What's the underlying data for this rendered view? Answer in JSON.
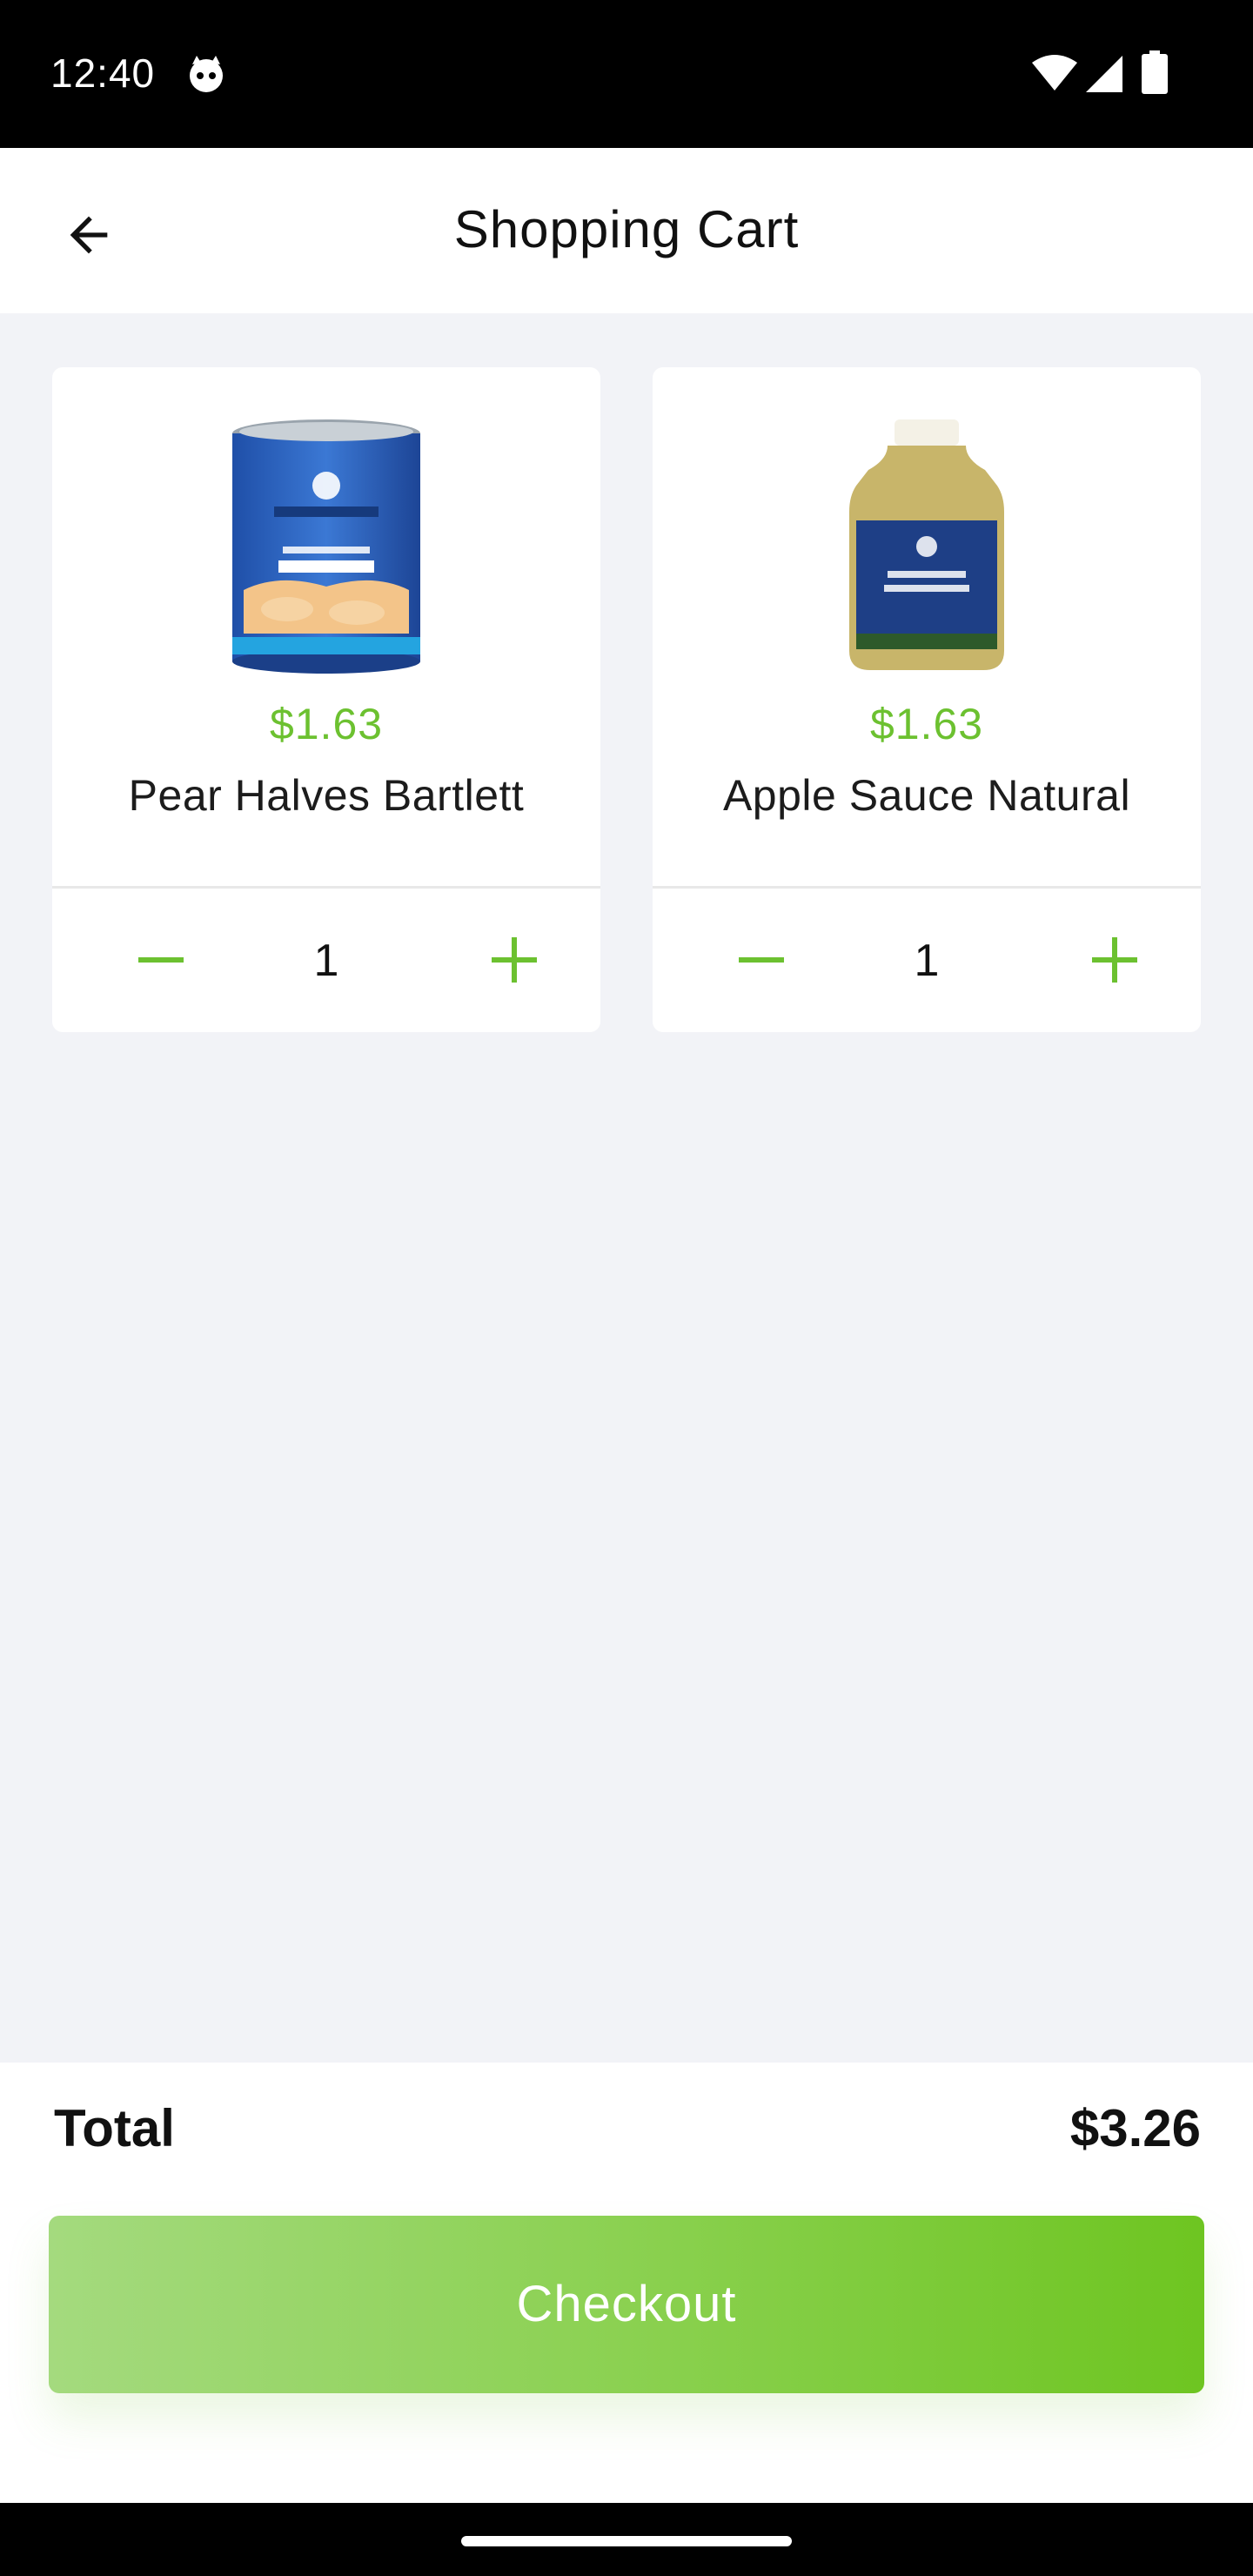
{
  "status_bar": {
    "time": "12:40"
  },
  "app_bar": {
    "title": "Shopping Cart"
  },
  "colors": {
    "accent": "#6cc130",
    "background": "#f2f3f7"
  },
  "cart": {
    "items": [
      {
        "price": "$1.63",
        "name": "Pear Halves Bartlett",
        "quantity": "1",
        "image_icon": "pear-halves-can"
      },
      {
        "price": "$1.63",
        "name": "Apple Sauce Natural",
        "quantity": "1",
        "image_icon": "apple-sauce-jar"
      }
    ]
  },
  "summary": {
    "total_label": "Total",
    "total_value": "$3.26",
    "checkout_label": "Checkout"
  }
}
